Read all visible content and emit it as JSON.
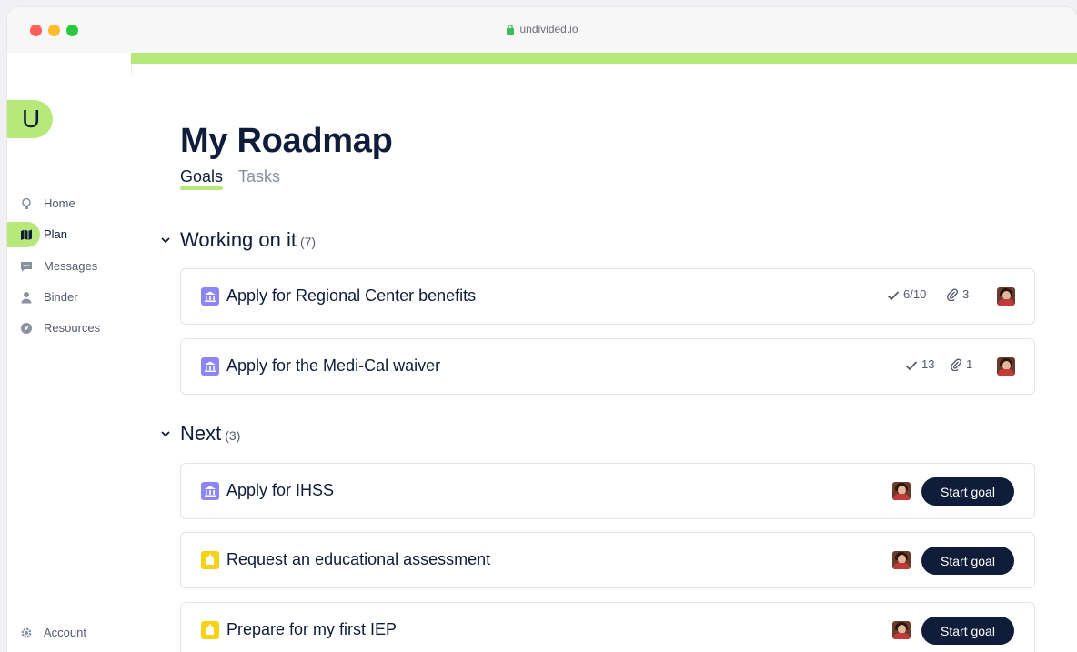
{
  "browser": {
    "url": "undivided.io"
  },
  "app": {
    "logo_letter": "U"
  },
  "sidebar": {
    "items": [
      {
        "label": "Home",
        "icon": "lightbulb-icon"
      },
      {
        "label": "Plan",
        "icon": "map-icon",
        "active": true
      },
      {
        "label": "Messages",
        "icon": "chat-icon"
      },
      {
        "label": "Binder",
        "icon": "person-icon"
      },
      {
        "label": "Resources",
        "icon": "compass-icon"
      }
    ],
    "account_label": "Account"
  },
  "page": {
    "title": "My Roadmap",
    "tabs": [
      {
        "label": "Goals",
        "active": true
      },
      {
        "label": "Tasks",
        "active": false
      }
    ]
  },
  "sections": [
    {
      "title": "Working on it",
      "count": "(7)",
      "goals": [
        {
          "title": "Apply for Regional Center benefits",
          "icon": "bank-icon",
          "tasks": "6/10",
          "attachments": "3"
        },
        {
          "title": "Apply for the Medi-Cal waiver",
          "icon": "bank-icon",
          "tasks": "13",
          "attachments": "1"
        }
      ]
    },
    {
      "title": "Next",
      "count": "(3)",
      "goals": [
        {
          "title": "Apply for IHSS",
          "icon": "bank-icon",
          "action": "Start goal"
        },
        {
          "title": "Request an educational assessment",
          "icon": "school-icon",
          "action": "Start goal"
        },
        {
          "title": "Prepare for my first IEP",
          "icon": "school-icon",
          "action": "Start goal"
        }
      ]
    }
  ],
  "colors": {
    "accent": "#b6e87a",
    "navy": "#0f1d3a",
    "bank_icon": "#8c86f5",
    "school_icon": "#f5d313"
  }
}
